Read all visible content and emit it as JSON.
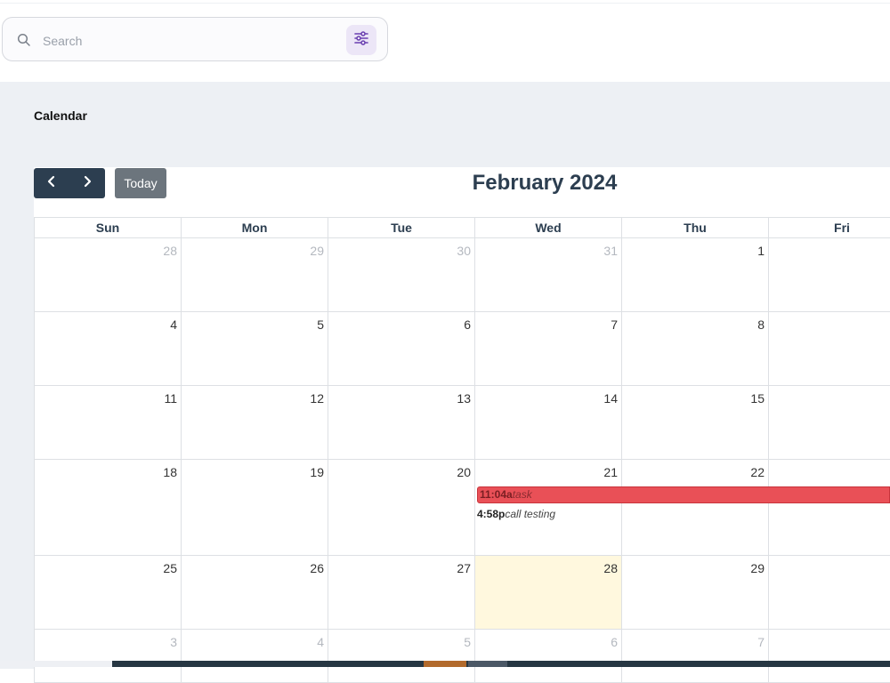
{
  "search": {
    "placeholder": "Search"
  },
  "calendar": {
    "section_title": "Calendar",
    "month_label": "February 2024",
    "today_label": "Today",
    "weekdays": [
      "Sun",
      "Mon",
      "Tue",
      "Wed",
      "Thu",
      "Fri"
    ],
    "weeks": [
      [
        "28",
        "29",
        "30",
        "31",
        "1",
        ""
      ],
      [
        "4",
        "5",
        "6",
        "7",
        "8",
        ""
      ],
      [
        "11",
        "12",
        "13",
        "14",
        "15",
        ""
      ],
      [
        "18",
        "19",
        "20",
        "21",
        "22",
        ""
      ],
      [
        "25",
        "26",
        "27",
        "28",
        "29",
        ""
      ],
      [
        "3",
        "4",
        "5",
        "6",
        "7",
        ""
      ]
    ],
    "events": [
      {
        "time": "11:04a",
        "title": "task",
        "color": "#e95057"
      },
      {
        "time": "4:58p",
        "title": "call testing"
      }
    ],
    "today_highlight": "#fff8de"
  },
  "icons": {
    "search": "search-icon",
    "filter": "sliders-icon",
    "prev": "chevron-left-icon",
    "next": "chevron-right-icon"
  }
}
